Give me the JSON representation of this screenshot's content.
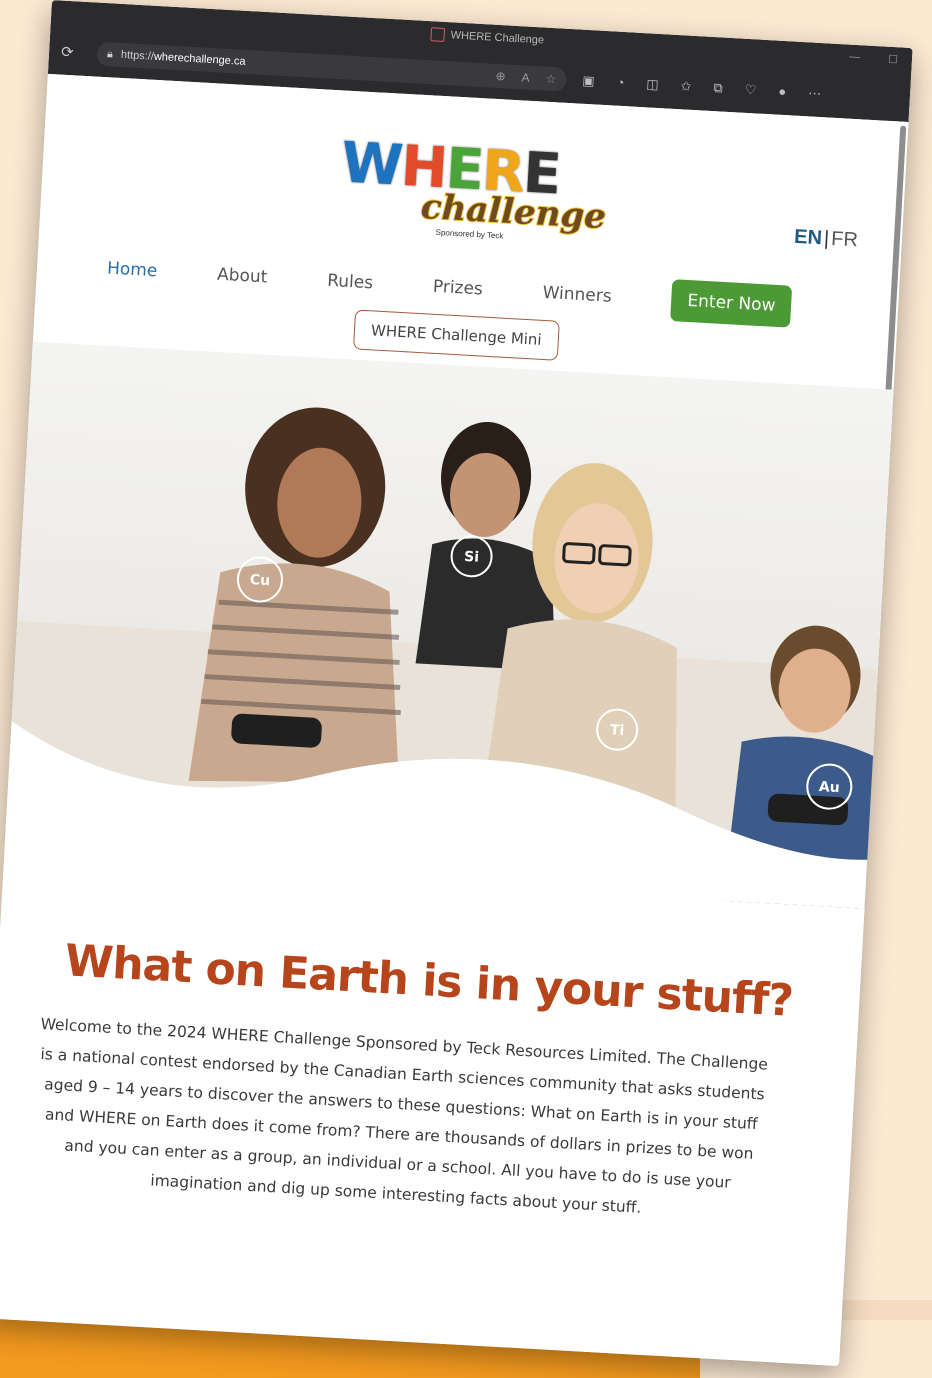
{
  "browser": {
    "tab_title": "WHERE Challenge",
    "url_prefix": "https://",
    "url_host": "wherechallenge.ca",
    "toolbar_icons": [
      "zoom-icon",
      "read-aloud-icon",
      "favorite-star-icon",
      "extension-icon",
      "copilot-icon",
      "split-screen-icon",
      "favorites-icon",
      "collections-icon",
      "heart-icon",
      "profile-avatar",
      "more-icon"
    ]
  },
  "site": {
    "logo": {
      "where": "WHERE",
      "challenge": "challenge",
      "sponsor": "Sponsored by Teck"
    },
    "lang": {
      "en": "EN",
      "separator": "|",
      "fr": "FR"
    },
    "nav": {
      "home": "Home",
      "about": "About",
      "rules": "Rules",
      "prizes": "Prizes",
      "winners": "Winners",
      "enter_now": "Enter Now",
      "mini": "WHERE Challenge Mini"
    },
    "hero": {
      "element_badges": [
        "Cu",
        "Si",
        "Ti",
        "Au"
      ]
    },
    "headline": "What on Earth is in your stuff?",
    "intro": "Welcome to the 2024 WHERE Challenge Sponsored by Teck Resources Limited. The Challenge is a national contest endorsed by the Canadian Earth sciences community that asks students aged 9 – 14 years to discover the answers to these questions: What on Earth is in your stuff and WHERE on Earth does it come from? There are thousands of dollars in prizes to be won and you can enter as a group, an individual or a school. All you have to do is use your imagination and dig up some interesting facts about your stuff."
  },
  "colors": {
    "background": "#fbe9d2",
    "headline": "#b6451c",
    "enter_button": "#4c9a36",
    "active_nav": "#2a6fa6",
    "orange_band": "#f39a1f"
  }
}
